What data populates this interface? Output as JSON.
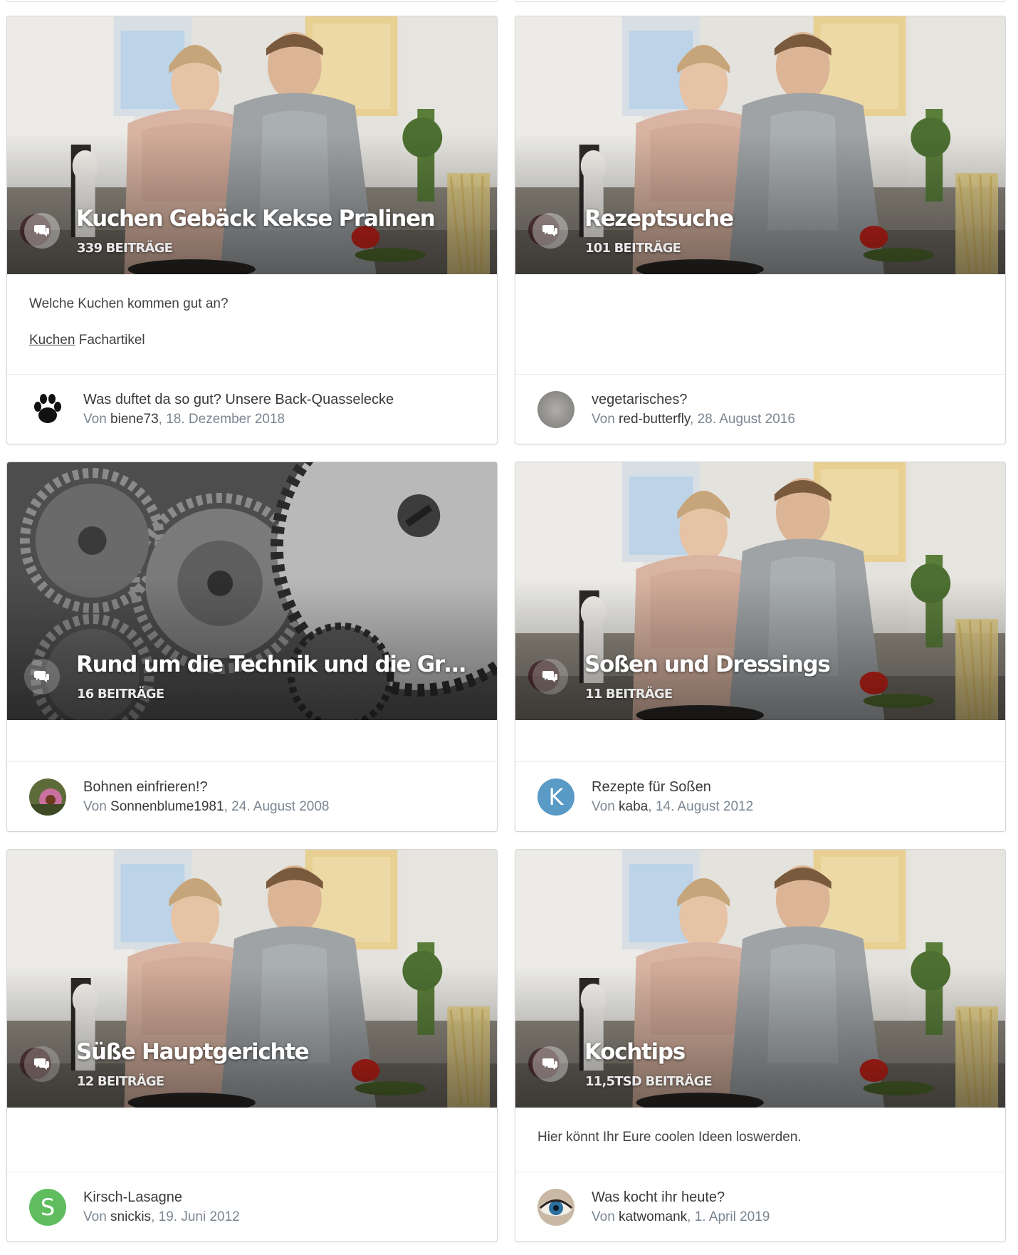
{
  "forums": [
    {
      "title": "Kuchen Gebäck Kekse Pralinen",
      "count": "339 BEITRÄGE",
      "image": "kitchen",
      "description": "Welche Kuchen kommen gut an?",
      "link_label": "Kuchen",
      "link_suffix": " Fachartikel",
      "last_topic": "Was duftet da so gut? Unsere Back-Quasselecke",
      "by_label": "Von",
      "author": "biene73",
      "date": "18. Dezember 2018",
      "avatar": "paw"
    },
    {
      "title": "Rezeptsuche",
      "count": "101 BEITRÄGE",
      "image": "kitchen",
      "description": "",
      "last_topic": "vegetarisches?",
      "by_label": "Von",
      "author": "red-butterfly",
      "date": "28. August 2016",
      "avatar": "grey-photo"
    },
    {
      "title": "Rund um die Technik und die Grundlagen",
      "count": "16 BEITRÄGE",
      "image": "gears",
      "description": "",
      "last_topic": "Bohnen einfrieren!?",
      "by_label": "Von",
      "author": "Sonnenblume1981",
      "date": "24. August 2008",
      "avatar": "flower-photo"
    },
    {
      "title": "Soßen und Dressings",
      "count": "11 BEITRÄGE",
      "image": "kitchen",
      "description": "",
      "last_topic": "Rezepte für Soßen",
      "by_label": "Von",
      "author": "kaba",
      "date": "14. August 2012",
      "avatar": "letter",
      "avatar_letter": "K",
      "avatar_color": "#5a9ac6"
    },
    {
      "title": "Süße Hauptgerichte",
      "count": "12 BEITRÄGE",
      "image": "kitchen",
      "description": "",
      "last_topic": "Kirsch-Lasagne",
      "by_label": "Von",
      "author": "snickis",
      "date": "19. Juni 2012",
      "avatar": "letter",
      "avatar_letter": "S",
      "avatar_color": "#5fbd5f"
    },
    {
      "title": "Kochtips",
      "count": "11,5TSD BEITRÄGE",
      "image": "kitchen",
      "description": "Hier könnt Ihr Eure coolen Ideen loswerden.",
      "last_topic": "Was kocht ihr heute?",
      "by_label": "Von",
      "author": "katwomank",
      "date": "1. April 2019",
      "avatar": "eye-photo"
    }
  ]
}
